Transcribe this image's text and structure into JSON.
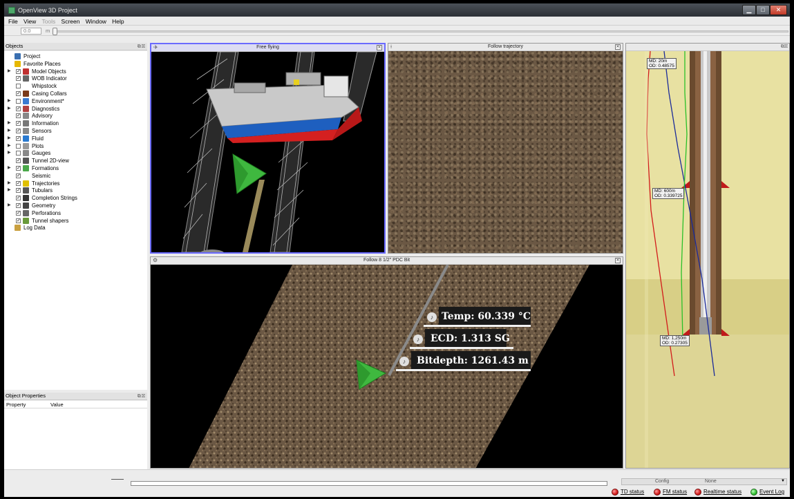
{
  "window": {
    "title": "OpenView 3D Project"
  },
  "menu": [
    {
      "label": "File",
      "enabled": true
    },
    {
      "label": "View",
      "enabled": true
    },
    {
      "label": "Tools",
      "enabled": false
    },
    {
      "label": "Screen",
      "enabled": true
    },
    {
      "label": "Window",
      "enabled": true
    },
    {
      "label": "Help",
      "enabled": true
    }
  ],
  "toolbar": {
    "speed_value": "0.0",
    "unit": "m"
  },
  "objects_panel": {
    "title": "Objects",
    "items": [
      {
        "label": "Project",
        "checked": null,
        "expandable": false,
        "icon": "project-icon"
      },
      {
        "label": "Favorite Places",
        "checked": null,
        "expandable": false,
        "icon": "star-icon"
      },
      {
        "label": "Model Objects",
        "checked": true,
        "expandable": true,
        "icon": "rig-icon"
      },
      {
        "label": "WOB Indicator",
        "checked": true,
        "expandable": false,
        "icon": "speaker-icon"
      },
      {
        "label": "Whipstock",
        "checked": false,
        "expandable": false,
        "icon": ""
      },
      {
        "label": "Casing Collars",
        "checked": true,
        "expandable": false,
        "icon": "casing-icon"
      },
      {
        "label": "Environment*",
        "checked": false,
        "expandable": true,
        "icon": "environment-icon"
      },
      {
        "label": "Diagnostics",
        "checked": true,
        "expandable": true,
        "icon": "exclamation-icon"
      },
      {
        "label": "Advisory",
        "checked": true,
        "expandable": false,
        "icon": "advisory-icon"
      },
      {
        "label": "Information",
        "checked": true,
        "expandable": true,
        "icon": "info-icon"
      },
      {
        "label": "Sensors",
        "checked": true,
        "expandable": true,
        "icon": "sensor-icon"
      },
      {
        "label": "Fluid",
        "checked": true,
        "expandable": true,
        "icon": "drop-icon"
      },
      {
        "label": "Plots",
        "checked": false,
        "expandable": true,
        "icon": "plot-icon"
      },
      {
        "label": "Gauges",
        "checked": false,
        "expandable": true,
        "icon": "gauge-icon"
      },
      {
        "label": "Tunnel 2D-view",
        "checked": true,
        "expandable": false,
        "icon": "tunnel-icon"
      },
      {
        "label": "Formations",
        "checked": true,
        "expandable": true,
        "icon": "formation-icon"
      },
      {
        "label": "Seismic",
        "checked": true,
        "expandable": false,
        "icon": ""
      },
      {
        "label": "Trajectories",
        "checked": true,
        "expandable": true,
        "icon": "trajectory-icon"
      },
      {
        "label": "Tubulars",
        "checked": true,
        "expandable": true,
        "icon": "tubular-icon"
      },
      {
        "label": "Completion Strings",
        "checked": true,
        "expandable": false,
        "icon": "completion-icon"
      },
      {
        "label": "Geometry",
        "checked": true,
        "expandable": true,
        "icon": "geometry-icon"
      },
      {
        "label": "Perforations",
        "checked": true,
        "expandable": false,
        "icon": "perforation-icon"
      },
      {
        "label": "Tunnel shapers",
        "checked": true,
        "expandable": false,
        "icon": "shaper-icon"
      },
      {
        "label": "Log Data",
        "checked": null,
        "expandable": false,
        "icon": "log-icon"
      }
    ]
  },
  "properties_panel": {
    "title": "Object Properties",
    "columns": [
      "Property",
      "Value"
    ]
  },
  "views": {
    "free_flying": {
      "title": "Free flying"
    },
    "follow_trajectory": {
      "title": "Follow trajectory"
    },
    "follow_bit": {
      "title": "Follow 8 1/2\" PDC Bit",
      "labels": [
        {
          "text": "Temp: 60.339 °C"
        },
        {
          "text": "ECD: 1.313 SG"
        },
        {
          "text": "Bitdepth: 1261.43 m"
        }
      ]
    },
    "well_section": {
      "labels": [
        {
          "md": "MD: 20m",
          "od": "OD: 0.48575"
        },
        {
          "md": "MD: 600m",
          "od": "OD: 0.339725"
        },
        {
          "md": "MD: 1,250m",
          "od": "OD: 0.27305"
        }
      ]
    }
  },
  "statusbar": {
    "config_label": "Config",
    "config_value": "None",
    "indicators": [
      {
        "label": "TD status",
        "color": "#d21a1a"
      },
      {
        "label": "FM status",
        "color": "#d21a1a"
      },
      {
        "label": "Realtime status",
        "color": "#d21a1a"
      },
      {
        "label": "Event Log",
        "color": "#2fbf2f"
      }
    ]
  }
}
